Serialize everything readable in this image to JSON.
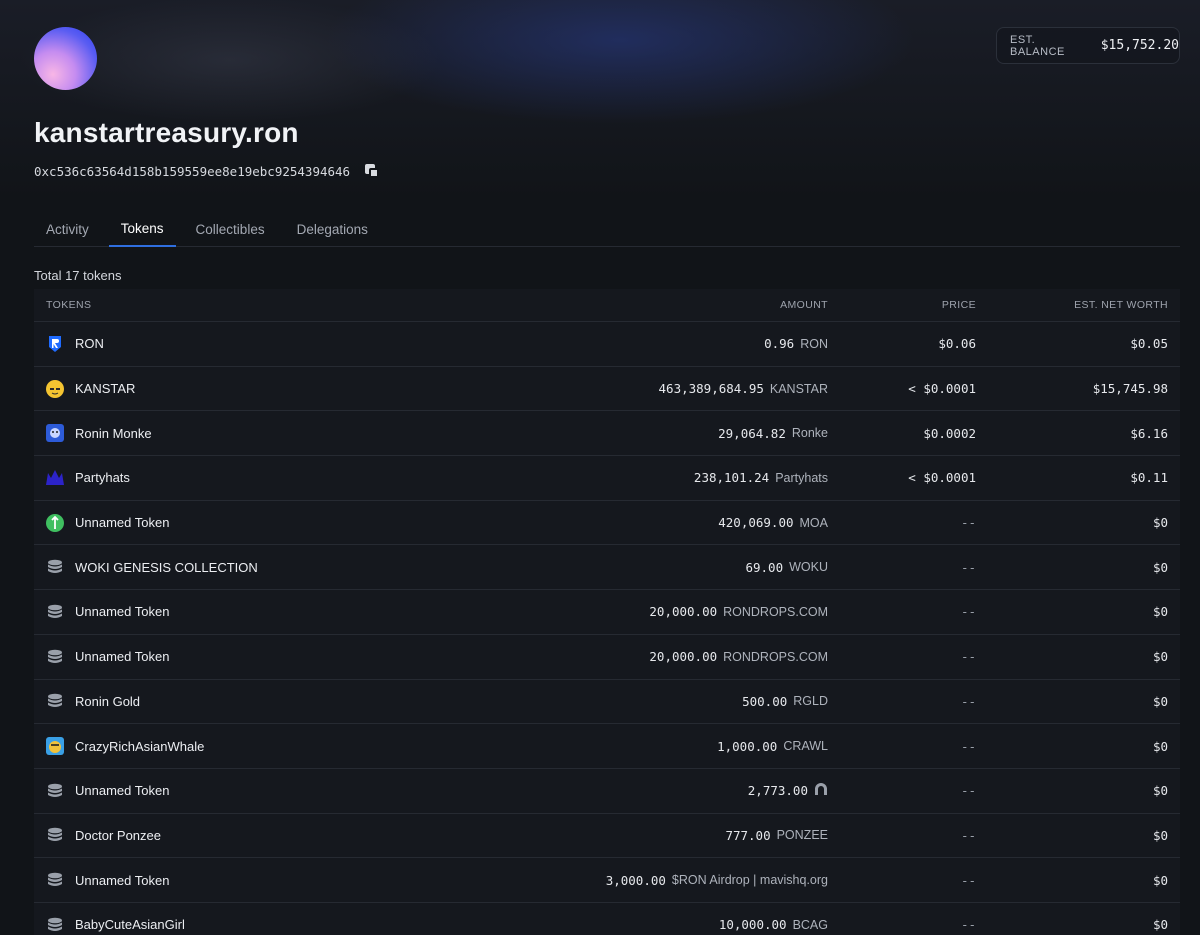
{
  "profile": {
    "name": "kanstartreasury.ron",
    "address": "0xc536c63564d158b159559ee8e19ebc9254394646"
  },
  "balance": {
    "label": "EST. BALANCE",
    "value": "$15,752.20"
  },
  "tabs": [
    {
      "label": "Activity",
      "active": false
    },
    {
      "label": "Tokens",
      "active": true
    },
    {
      "label": "Collectibles",
      "active": false
    },
    {
      "label": "Delegations",
      "active": false
    }
  ],
  "total_text": "Total 17 tokens",
  "table": {
    "headers": {
      "tokens": "TOKENS",
      "amount": "AMOUNT",
      "price": "PRICE",
      "net": "EST. NET WORTH"
    },
    "rows": [
      {
        "icon": "ron-icon",
        "name": "RON",
        "amount": "0.96",
        "symbol": "RON",
        "price": "$0.06",
        "net": "$0.05"
      },
      {
        "icon": "kanstar-icon",
        "name": "KANSTAR",
        "amount": "463,389,684.95",
        "symbol": "KANSTAR",
        "price": "< $0.0001",
        "net": "$15,745.98"
      },
      {
        "icon": "ronin-monke-icon",
        "name": "Ronin Monke",
        "amount": "29,064.82",
        "symbol": "Ronke",
        "price": "$0.0002",
        "net": "$6.16"
      },
      {
        "icon": "partyhats-icon",
        "name": "Partyhats",
        "amount": "238,101.24",
        "symbol": "Partyhats",
        "price": "< $0.0001",
        "net": "$0.11"
      },
      {
        "icon": "moa-icon",
        "name": "Unnamed Token",
        "amount": "420,069.00",
        "symbol": "MOA",
        "price": "--",
        "net": "$0"
      },
      {
        "icon": "coin-stack-icon",
        "name": "WOKI GENESIS COLLECTION",
        "amount": "69.00",
        "symbol": "WOKU",
        "price": "--",
        "net": "$0"
      },
      {
        "icon": "coin-stack-icon",
        "name": "Unnamed Token",
        "amount": "20,000.00",
        "symbol": "RONDROPS.COM",
        "price": "--",
        "net": "$0"
      },
      {
        "icon": "coin-stack-icon",
        "name": "Unnamed Token",
        "amount": "20,000.00",
        "symbol": "RONDROPS.COM",
        "price": "--",
        "net": "$0"
      },
      {
        "icon": "coin-stack-icon",
        "name": "Ronin Gold",
        "amount": "500.00",
        "symbol": "RGLD",
        "price": "--",
        "net": "$0"
      },
      {
        "icon": "crazyrich-icon",
        "name": "CrazyRichAsianWhale",
        "amount": "1,000.00",
        "symbol": "CRAWL",
        "price": "--",
        "net": "$0"
      },
      {
        "icon": "coin-stack-icon",
        "name": "Unnamed Token",
        "amount": "2,773.00",
        "symbol": "",
        "symbol_icon": "arch-icon",
        "price": "--",
        "net": "$0"
      },
      {
        "icon": "coin-stack-icon",
        "name": "Doctor Ponzee",
        "amount": "777.00",
        "symbol": "PONZEE",
        "price": "--",
        "net": "$0"
      },
      {
        "icon": "coin-stack-icon",
        "name": "Unnamed Token",
        "amount": "3,000.00",
        "symbol": "$RON Airdrop | mavishq.org",
        "price": "--",
        "net": "$0"
      },
      {
        "icon": "coin-stack-icon",
        "name": "BabyCuteAsianGirl",
        "amount": "10,000.00",
        "symbol": "BCAG",
        "price": "--",
        "net": "$0"
      }
    ]
  },
  "colors": {
    "accent": "#2f6fe0",
    "background": "#111418",
    "row": "#15181e"
  }
}
